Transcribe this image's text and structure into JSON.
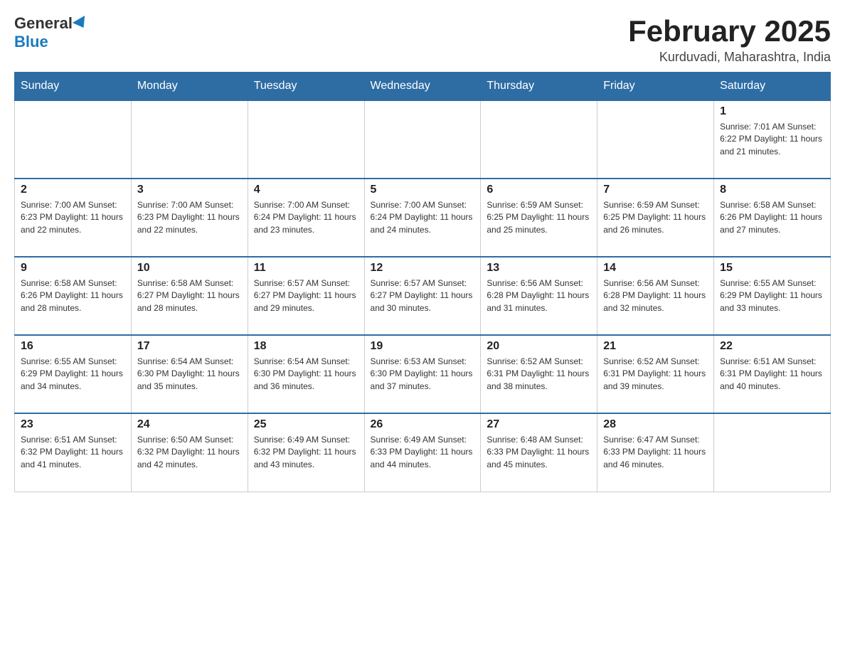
{
  "logo": {
    "general": "General",
    "blue": "Blue"
  },
  "header": {
    "month_title": "February 2025",
    "location": "Kurduvadi, Maharashtra, India"
  },
  "days_of_week": [
    "Sunday",
    "Monday",
    "Tuesday",
    "Wednesday",
    "Thursday",
    "Friday",
    "Saturday"
  ],
  "weeks": [
    [
      {
        "day": "",
        "info": ""
      },
      {
        "day": "",
        "info": ""
      },
      {
        "day": "",
        "info": ""
      },
      {
        "day": "",
        "info": ""
      },
      {
        "day": "",
        "info": ""
      },
      {
        "day": "",
        "info": ""
      },
      {
        "day": "1",
        "info": "Sunrise: 7:01 AM\nSunset: 6:22 PM\nDaylight: 11 hours and 21 minutes."
      }
    ],
    [
      {
        "day": "2",
        "info": "Sunrise: 7:00 AM\nSunset: 6:23 PM\nDaylight: 11 hours and 22 minutes."
      },
      {
        "day": "3",
        "info": "Sunrise: 7:00 AM\nSunset: 6:23 PM\nDaylight: 11 hours and 22 minutes."
      },
      {
        "day": "4",
        "info": "Sunrise: 7:00 AM\nSunset: 6:24 PM\nDaylight: 11 hours and 23 minutes."
      },
      {
        "day": "5",
        "info": "Sunrise: 7:00 AM\nSunset: 6:24 PM\nDaylight: 11 hours and 24 minutes."
      },
      {
        "day": "6",
        "info": "Sunrise: 6:59 AM\nSunset: 6:25 PM\nDaylight: 11 hours and 25 minutes."
      },
      {
        "day": "7",
        "info": "Sunrise: 6:59 AM\nSunset: 6:25 PM\nDaylight: 11 hours and 26 minutes."
      },
      {
        "day": "8",
        "info": "Sunrise: 6:58 AM\nSunset: 6:26 PM\nDaylight: 11 hours and 27 minutes."
      }
    ],
    [
      {
        "day": "9",
        "info": "Sunrise: 6:58 AM\nSunset: 6:26 PM\nDaylight: 11 hours and 28 minutes."
      },
      {
        "day": "10",
        "info": "Sunrise: 6:58 AM\nSunset: 6:27 PM\nDaylight: 11 hours and 28 minutes."
      },
      {
        "day": "11",
        "info": "Sunrise: 6:57 AM\nSunset: 6:27 PM\nDaylight: 11 hours and 29 minutes."
      },
      {
        "day": "12",
        "info": "Sunrise: 6:57 AM\nSunset: 6:27 PM\nDaylight: 11 hours and 30 minutes."
      },
      {
        "day": "13",
        "info": "Sunrise: 6:56 AM\nSunset: 6:28 PM\nDaylight: 11 hours and 31 minutes."
      },
      {
        "day": "14",
        "info": "Sunrise: 6:56 AM\nSunset: 6:28 PM\nDaylight: 11 hours and 32 minutes."
      },
      {
        "day": "15",
        "info": "Sunrise: 6:55 AM\nSunset: 6:29 PM\nDaylight: 11 hours and 33 minutes."
      }
    ],
    [
      {
        "day": "16",
        "info": "Sunrise: 6:55 AM\nSunset: 6:29 PM\nDaylight: 11 hours and 34 minutes."
      },
      {
        "day": "17",
        "info": "Sunrise: 6:54 AM\nSunset: 6:30 PM\nDaylight: 11 hours and 35 minutes."
      },
      {
        "day": "18",
        "info": "Sunrise: 6:54 AM\nSunset: 6:30 PM\nDaylight: 11 hours and 36 minutes."
      },
      {
        "day": "19",
        "info": "Sunrise: 6:53 AM\nSunset: 6:30 PM\nDaylight: 11 hours and 37 minutes."
      },
      {
        "day": "20",
        "info": "Sunrise: 6:52 AM\nSunset: 6:31 PM\nDaylight: 11 hours and 38 minutes."
      },
      {
        "day": "21",
        "info": "Sunrise: 6:52 AM\nSunset: 6:31 PM\nDaylight: 11 hours and 39 minutes."
      },
      {
        "day": "22",
        "info": "Sunrise: 6:51 AM\nSunset: 6:31 PM\nDaylight: 11 hours and 40 minutes."
      }
    ],
    [
      {
        "day": "23",
        "info": "Sunrise: 6:51 AM\nSunset: 6:32 PM\nDaylight: 11 hours and 41 minutes."
      },
      {
        "day": "24",
        "info": "Sunrise: 6:50 AM\nSunset: 6:32 PM\nDaylight: 11 hours and 42 minutes."
      },
      {
        "day": "25",
        "info": "Sunrise: 6:49 AM\nSunset: 6:32 PM\nDaylight: 11 hours and 43 minutes."
      },
      {
        "day": "26",
        "info": "Sunrise: 6:49 AM\nSunset: 6:33 PM\nDaylight: 11 hours and 44 minutes."
      },
      {
        "day": "27",
        "info": "Sunrise: 6:48 AM\nSunset: 6:33 PM\nDaylight: 11 hours and 45 minutes."
      },
      {
        "day": "28",
        "info": "Sunrise: 6:47 AM\nSunset: 6:33 PM\nDaylight: 11 hours and 46 minutes."
      },
      {
        "day": "",
        "info": ""
      }
    ]
  ]
}
